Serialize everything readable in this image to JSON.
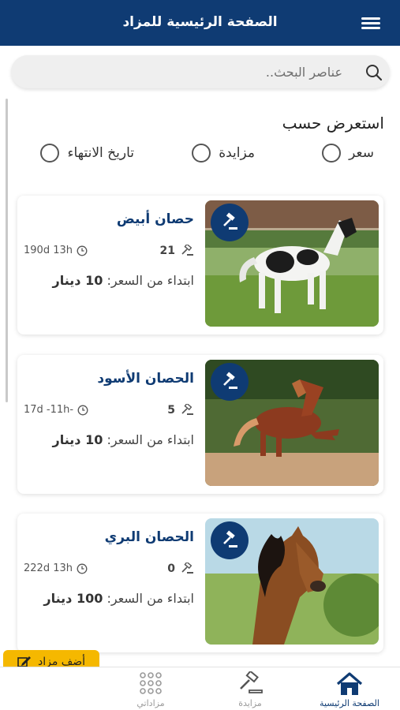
{
  "header": {
    "title": "الصفحة الرئيسية للمزاد",
    "menu_icon": "hamburger-menu-icon"
  },
  "search": {
    "placeholder": "عناصر البحث..",
    "icon": "search-icon"
  },
  "sort": {
    "title": "استعرض حسب",
    "options": [
      {
        "label": "سعر"
      },
      {
        "label": "مزايدة"
      },
      {
        "label": "تاريخ الانتهاء"
      }
    ]
  },
  "auctions": [
    {
      "name": "حصان أبيض",
      "bids": "21",
      "time": "190d 13h",
      "price_label": "ابتداء من السعر:",
      "price_value": "10 دينار"
    },
    {
      "name": "الحصان الأسود",
      "bids": "5",
      "time": "17d -11h-",
      "price_label": "ابتداء من السعر:",
      "price_value": "10 دينار"
    },
    {
      "name": "الحصان البري",
      "bids": "0",
      "time": "222d 13h",
      "price_label": "ابتداء من السعر:",
      "price_value": "100 دينار"
    }
  ],
  "add_button": {
    "label": "أضف مزاد"
  },
  "bottom_nav": [
    {
      "label": "الصفحة الرئيسية",
      "icon": "home-icon",
      "active": true
    },
    {
      "label": "مزايدة",
      "icon": "gavel-icon",
      "active": false
    },
    {
      "label": "مزاداتي",
      "icon": "grid-icon",
      "active": false
    }
  ],
  "colors": {
    "primary": "#0f3b73",
    "accent": "#f5b800",
    "muted": "#9a9a9a"
  }
}
